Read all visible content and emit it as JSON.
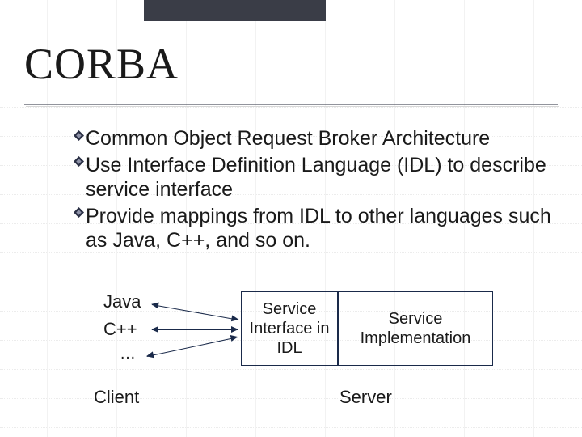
{
  "title": "CORBA",
  "bullets": [
    "Common Object Request Broker Architecture",
    "Use Interface Definition Language (IDL) to describe service interface",
    "Provide mappings from IDL to other languages such as Java, C++, and so on."
  ],
  "diagram": {
    "client_languages": [
      "Java",
      "C++",
      "…"
    ],
    "client_caption": "Client",
    "box_interface": "Service Interface in IDL",
    "box_impl": "Service Implementation",
    "server_caption": "Server"
  },
  "colors": {
    "header_bar": "#3a3d47",
    "rule": "#4a4d5a",
    "box_border": "#1a2a4a"
  },
  "icons": {
    "bullet": "diamond-bullet-icon"
  }
}
